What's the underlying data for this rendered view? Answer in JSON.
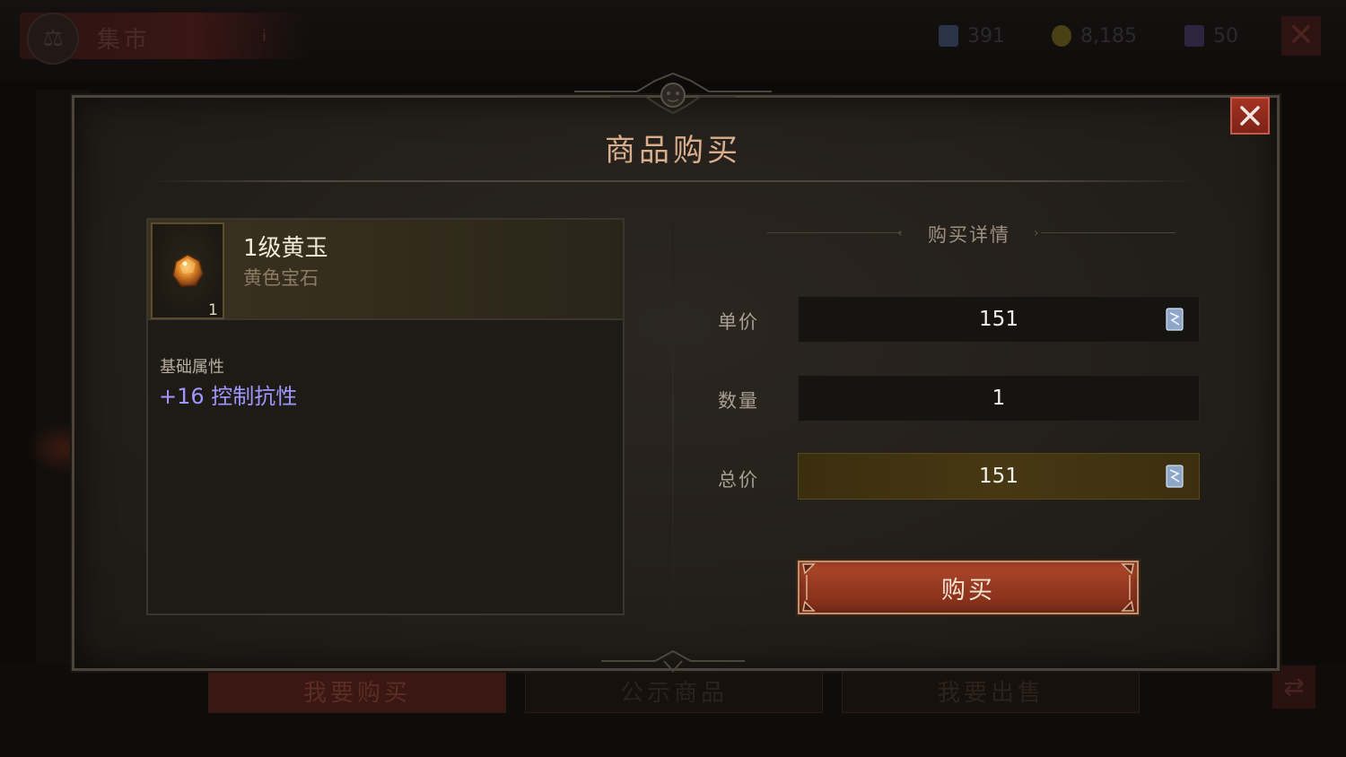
{
  "background": {
    "screen_title": "集市",
    "currencies": [
      {
        "icon": "platinum-icon",
        "value": "391",
        "color": "#3a4a66"
      },
      {
        "icon": "gold-coin-icon",
        "value": "8,185",
        "color": "#6a5a20"
      },
      {
        "icon": "crystal-shard-icon",
        "value": "50",
        "color": "#4a3a66"
      }
    ],
    "tabs": [
      {
        "label": "我要购买",
        "active": true
      },
      {
        "label": "公示商品",
        "active": false
      },
      {
        "label": "我要出售",
        "active": false
      }
    ]
  },
  "modal": {
    "title": "商品购买",
    "close_icon": "close-icon"
  },
  "item": {
    "name": "1级黄玉",
    "type": "黄色宝石",
    "count": "1",
    "icon": "topaz-gem-icon",
    "attributes_heading": "基础属性",
    "attribute": "+16 控制抗性"
  },
  "details": {
    "title": "购买详情",
    "unit_price_label": "单价",
    "unit_price": "151",
    "quantity_label": "数量",
    "quantity": "1",
    "total_label": "总价",
    "total": "151",
    "currency_icon": "platinum-icon",
    "buy_label": "购买"
  },
  "colors": {
    "title": "#d9ae8c",
    "attribute": "#9f96ff",
    "buy_button": "#973a22",
    "close_button": "#a33222"
  }
}
